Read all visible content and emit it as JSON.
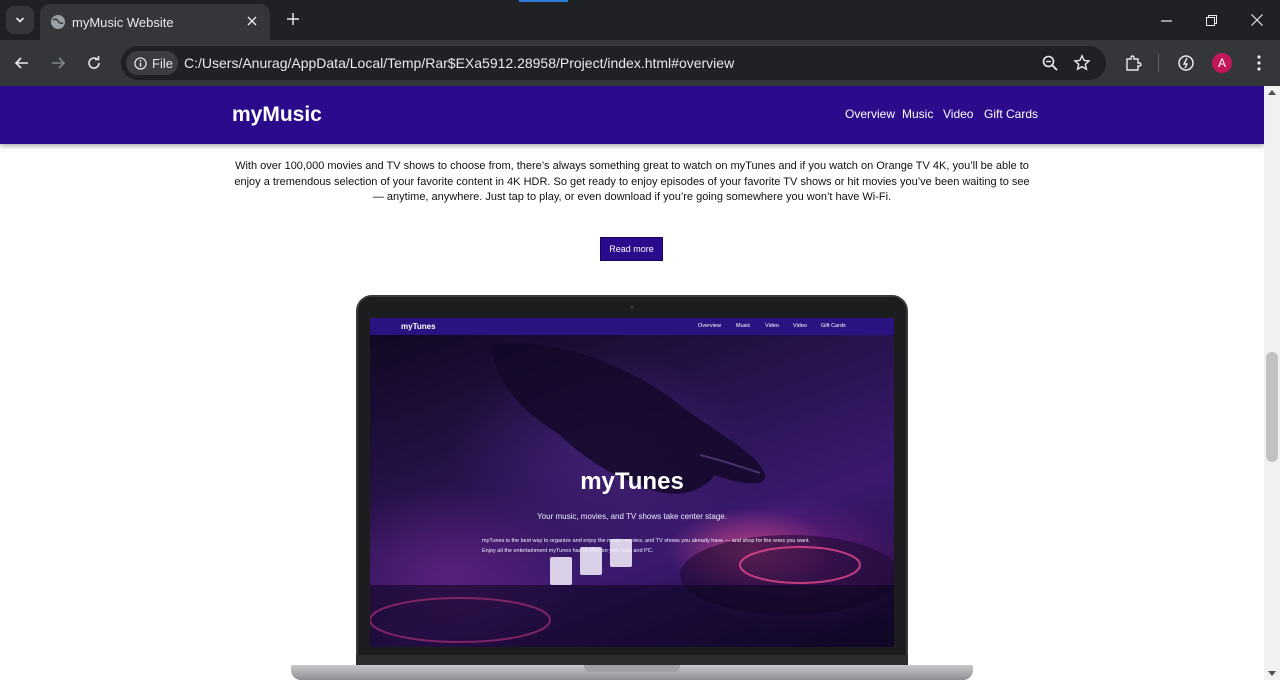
{
  "browser": {
    "tab_title": "myMusic Website",
    "site_info_label": "File",
    "url": "C:/Users/Anurag/AppData/Local/Temp/Rar$EXa5912.28958/Project/index.html#overview",
    "avatar_letter": "A"
  },
  "site": {
    "brand": "myMusic",
    "nav": [
      "Overview",
      "Music",
      "Video",
      "Gift Cards"
    ],
    "overview_text": "With over 100,000 movies and TV shows to choose from, there’s always something great to watch on myTunes and if you watch on Orange TV 4K, you’ll be able to enjoy a tremendous selection of your favorite content in 4K HDR. So get ready to enjoy episodes of your favorite TV shows or hit movies you’ve been waiting to see — anytime, anywhere. Just tap to play, or even download if you’re going somewhere you won’t have Wi-Fi.",
    "read_more_label": "Read more"
  },
  "laptop_screen": {
    "brand": "myTunes",
    "nav": [
      "Overview",
      "Music",
      "Video",
      "Video",
      "Gift Cards"
    ],
    "hero_title": "myTunes",
    "hero_subtitle": "Your music, movies, and TV shows take center stage.",
    "hero_body": "myTunes is the best way to organize and enjoy the music, movies, and TV shows you already have — and shop for the ones you want. Enjoy all the entertainment myTunes has to offer on your Mac and PC."
  },
  "colors": {
    "nav_purple": "#2b0a8c",
    "chrome_dark": "#202124",
    "chrome_toolbar": "#35363a"
  }
}
